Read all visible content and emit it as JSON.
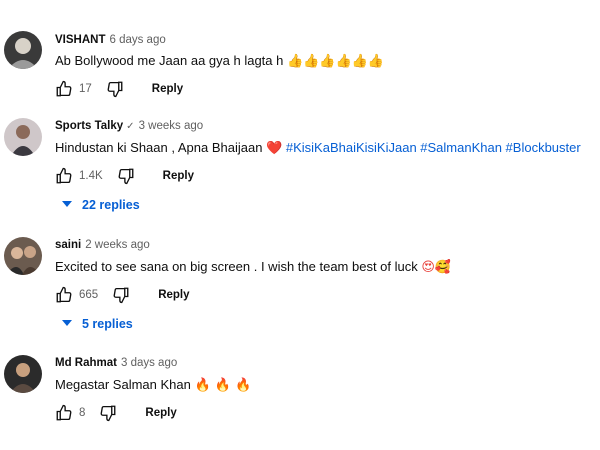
{
  "comments": [
    {
      "author": "VISHANT",
      "verified": "",
      "time": "6 days ago",
      "text": "Ab Bollywood me Jaan aa gya h lagta h",
      "emojis": "👍👍👍👍👍👍",
      "likes": "17",
      "reply_label": "Reply",
      "replies_label": ""
    },
    {
      "author": "Sports Talky",
      "verified": "✓",
      "time": "3 weeks ago",
      "text": "Hindustan ki Shaan , Apna Bhaijaan",
      "emojis": "❤️",
      "hashtags": "#KisiKaBhaiKisiKiJaan #SalmanKhan #Blockbuster",
      "likes": "1.4K",
      "reply_label": "Reply",
      "replies_label": "22 replies"
    },
    {
      "author": "saini",
      "verified": "",
      "time": "2 weeks ago",
      "text": "Excited to see sana on big screen . I wish the team best of luck",
      "emojis": "😍🥰",
      "likes": "665",
      "reply_label": "Reply",
      "replies_label": "5 replies"
    },
    {
      "author": "Md Rahmat",
      "verified": "",
      "time": "3 days ago",
      "text": "Megastar Salman Khan",
      "emojis": "🔥 🔥 🔥",
      "likes": "8",
      "reply_label": "Reply",
      "replies_label": ""
    }
  ],
  "icons": {
    "like": "thumbs-up-icon",
    "dislike": "thumbs-down-icon",
    "expand": "caret-down-icon"
  },
  "colors": {
    "link": "#065fd4",
    "secondary_text": "#606060",
    "heart": "#e02020",
    "fire": "#f26a1b",
    "thumb": "#f6b21a"
  }
}
